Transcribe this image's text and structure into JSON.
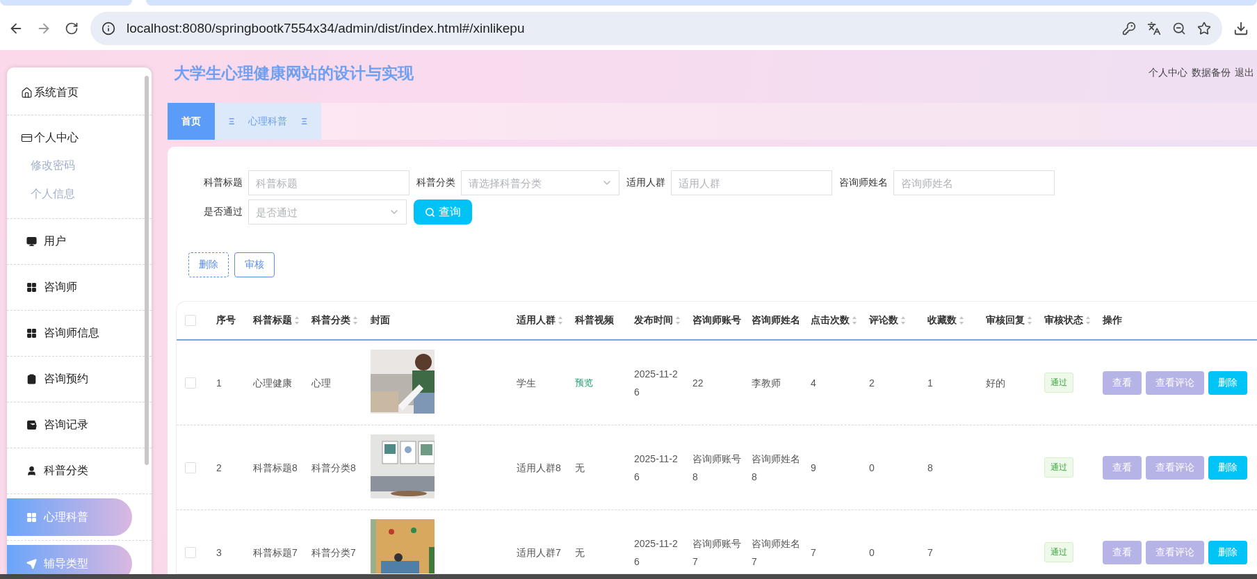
{
  "browser": {
    "url": "localhost:8080/springbootk7554x34/admin/dist/index.html#/xinlikepu"
  },
  "header": {
    "title": "大学生心理健康网站的设计与实现",
    "links": [
      "个人中心",
      "数据备份",
      "退出"
    ]
  },
  "sidebar": {
    "items": [
      {
        "label": "系统首页",
        "selected": false,
        "hovered": false
      },
      {
        "label": "个人中心",
        "selected": false,
        "hovered": false,
        "children": [
          {
            "label": "修改密码",
            "selected": false
          },
          {
            "label": "个人信息",
            "selected": false
          }
        ]
      },
      {
        "label": "用户",
        "selected": false,
        "hovered": false
      },
      {
        "label": "咨询师",
        "selected": false,
        "hovered": false
      },
      {
        "label": "咨询师信息",
        "selected": false,
        "hovered": false
      },
      {
        "label": "咨询预约",
        "selected": false,
        "hovered": false
      },
      {
        "label": "咨询记录",
        "selected": false,
        "hovered": false
      },
      {
        "label": "科普分类",
        "selected": false,
        "hovered": false
      },
      {
        "label": "心理科普",
        "selected": true,
        "hovered": false
      },
      {
        "label": "辅导类型",
        "selected": false,
        "hovered": true
      }
    ]
  },
  "tabs": [
    {
      "label": "首页",
      "selected": true
    },
    {
      "label": "心理科普",
      "selected": false,
      "icon_before": "Ξ",
      "icon_after": "Ξ"
    }
  ],
  "filters": [
    {
      "label": "科普标题",
      "kind": "input",
      "placeholder": "科普标题"
    },
    {
      "label": "科普分类",
      "kind": "select",
      "placeholder": "请选择科普分类"
    },
    {
      "label": "适用人群",
      "kind": "input",
      "placeholder": "适用人群"
    },
    {
      "label": "咨询师姓名",
      "kind": "input",
      "placeholder": "咨询师姓名"
    },
    {
      "label": "是否通过",
      "kind": "select",
      "placeholder": "是否通过"
    }
  ],
  "search_button": "查询",
  "bulk_buttons": [
    {
      "label": "删除",
      "kind": "dashed"
    },
    {
      "label": "审核",
      "kind": "solid"
    }
  ],
  "table": {
    "header_checked": false,
    "columns": [
      {
        "label": "序号",
        "sortable": false
      },
      {
        "label": "科普标题",
        "sortable": true
      },
      {
        "label": "科普分类",
        "sortable": true
      },
      {
        "label": "封面",
        "sortable": false
      },
      {
        "label": "适用人群",
        "sortable": true
      },
      {
        "label": "科普视频",
        "sortable": false
      },
      {
        "label": "发布时间",
        "sortable": true
      },
      {
        "label": "咨询师账号",
        "sortable": false
      },
      {
        "label": "咨询师姓名",
        "sortable": false
      },
      {
        "label": "点击次数",
        "sortable": true
      },
      {
        "label": "评论数",
        "sortable": true
      },
      {
        "label": "收藏数",
        "sortable": true
      },
      {
        "label": "审核回复",
        "sortable": true
      },
      {
        "label": "审核状态",
        "sortable": true
      },
      {
        "label": "操作",
        "sortable": false
      }
    ],
    "rows": [
      {
        "checked": false,
        "index": "1",
        "title": "心理健康",
        "category": "心理",
        "audience": "学生",
        "video": {
          "text": "预览",
          "link": true
        },
        "time": "2025-11-26",
        "account": "22",
        "name": "李教师",
        "clicks": "4",
        "comments": "2",
        "favorites": "1",
        "reply": "好的",
        "status": "通过",
        "actions": [
          {
            "label": "查看",
            "kind": "view"
          },
          {
            "label": "查看评论",
            "kind": "view"
          },
          {
            "label": "删除",
            "kind": "delete"
          }
        ]
      },
      {
        "checked": false,
        "index": "2",
        "title": "科普标题8",
        "category": "科普分类8",
        "audience": "适用人群8",
        "video": {
          "text": "无",
          "link": false
        },
        "time": "2025-11-26",
        "account": "咨询师账号8",
        "name": "咨询师姓名8",
        "clicks": "9",
        "comments": "0",
        "favorites": "8",
        "status": "通过",
        "actions": [
          {
            "label": "查看",
            "kind": "view"
          },
          {
            "label": "查看评论",
            "kind": "view"
          },
          {
            "label": "删除",
            "kind": "delete"
          }
        ]
      },
      {
        "checked": false,
        "index": "3",
        "title": "科普标题7",
        "category": "科普分类7",
        "audience": "适用人群7",
        "video": {
          "text": "无",
          "link": false
        },
        "time": "2025-11-26",
        "account": "咨询师账号7",
        "name": "咨询师姓名7",
        "clicks": "7",
        "comments": "0",
        "favorites": "7",
        "status": "通过",
        "actions": [
          {
            "label": "查看",
            "kind": "view"
          },
          {
            "label": "查看评论",
            "kind": "view"
          },
          {
            "label": "删除",
            "kind": "delete"
          }
        ]
      }
    ]
  }
}
